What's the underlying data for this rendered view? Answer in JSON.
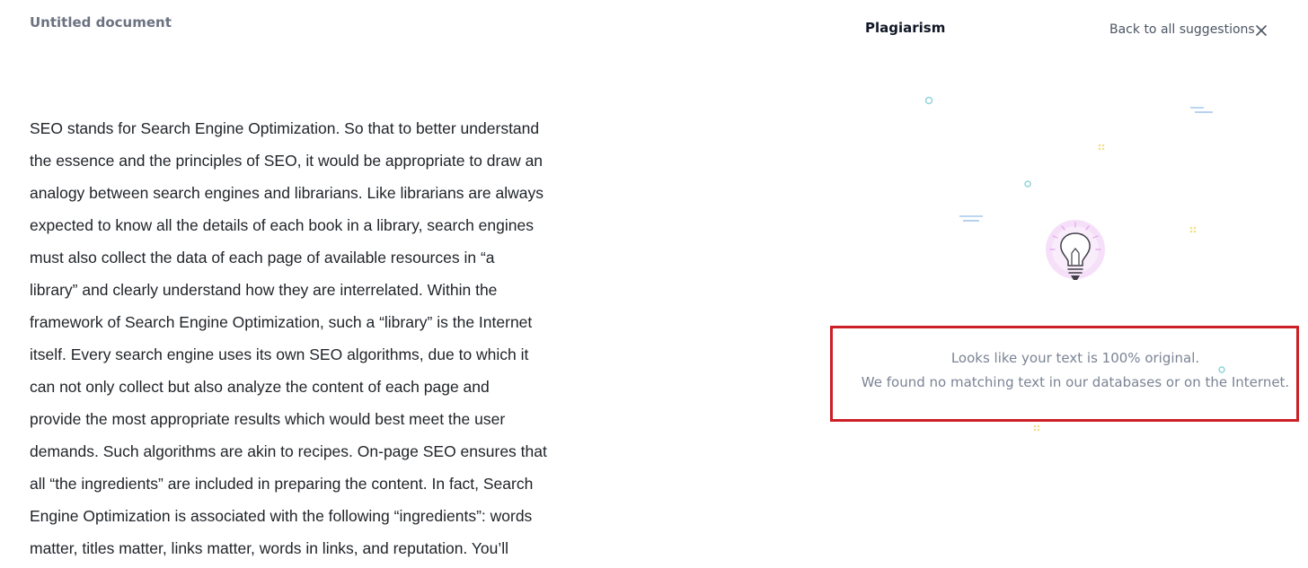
{
  "document": {
    "title": "Untitled document",
    "lines": [
      "SEO stands for Search Engine Optimization. So that to better understand",
      "the essence and the principles of SEO, it would be appropriate to draw an",
      "analogy between search engines and librarians. Like librarians are always",
      "expected to know all the details of each book in a library, search engines",
      "must also collect the data of each page of available resources in “a",
      "library” and clearly understand how they are interrelated. Within the",
      "framework of Search Engine Optimization, such a “library” is the Internet",
      "itself. Every search engine uses its own SEO algorithms, due to which it",
      "can not only collect but also analyze the content of each page and",
      "provide the most appropriate results which would best meet the user",
      "demands. Such algorithms are akin to recipes. On-page SEO ensures that",
      "all “the ingredients” are included in preparing the content. In fact, Search",
      "Engine Optimization is associated with the following “ingredients”: words",
      "matter, titles matter, links matter, words in links, and reputation. You’ll"
    ]
  },
  "panel": {
    "title": "Plagiarism",
    "back_label": "Back to all suggestions",
    "close_icon": "close-icon",
    "illustration_icon": "lightbulb-icon",
    "result_line1": "Looks like your text is 100% original.",
    "result_line2": "We found no matching text in our databases or on the Internet."
  },
  "colors": {
    "highlight_border": "#cc1f26",
    "bulb_glow": "#f3d4f7",
    "accent_teal": "#8fd3d9",
    "accent_yellow": "#f2e08a"
  }
}
